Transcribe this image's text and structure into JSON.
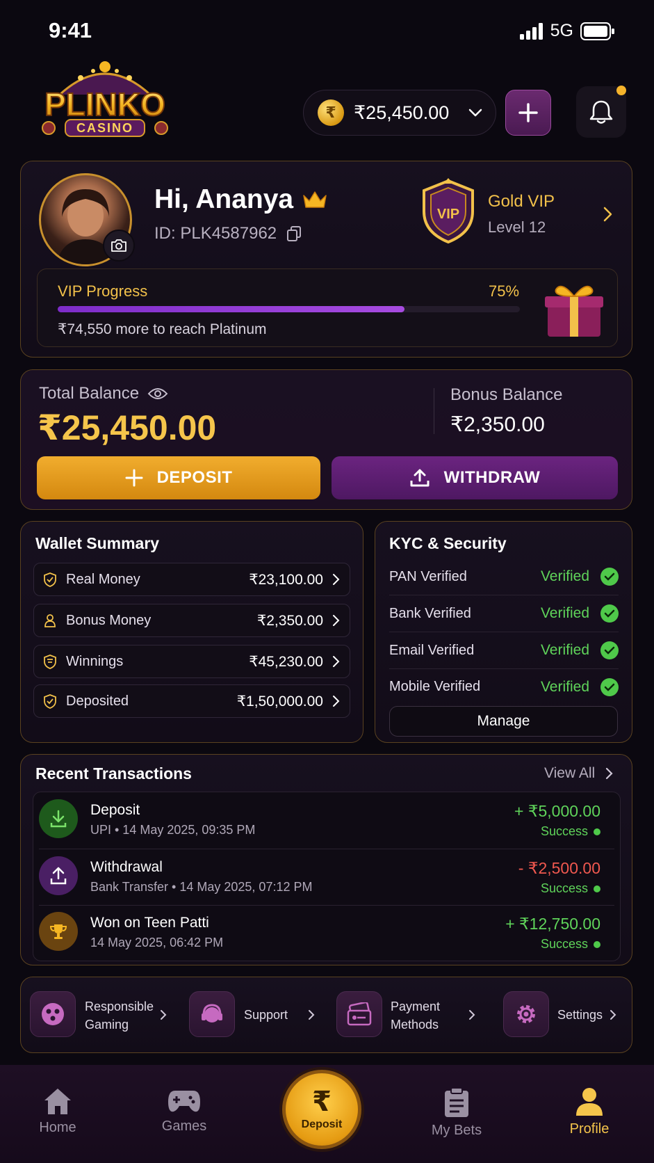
{
  "status_bar": {
    "time": "9:41",
    "network": "5G"
  },
  "header": {
    "logo_main": "PLINKO",
    "logo_sub": "CASINO",
    "balance": "₹25,450.00",
    "coin_symbol": "₹"
  },
  "profile": {
    "greeting": "Hi, Ananya",
    "user_id": "ID: PLK4587962",
    "vip_badge": "VIP",
    "vip_tier": "Gold VIP",
    "vip_level": "Level 12",
    "progress_label": "VIP Progress",
    "progress_percent_text": "75%",
    "progress_fraction": 0.75,
    "progress_note": "₹74,550 more to reach Platinum"
  },
  "balance": {
    "total_label": "Total Balance",
    "total_amount": "₹25,450.00",
    "bonus_label": "Bonus Balance",
    "bonus_amount": "₹2,350.00",
    "deposit_label": "DEPOSIT",
    "withdraw_label": "WITHDRAW"
  },
  "wallet_summary": {
    "title": "Wallet Summary",
    "rows": [
      {
        "label": "Real Money",
        "value": "₹23,100.00"
      },
      {
        "label": "Bonus Money",
        "value": "₹2,350.00"
      },
      {
        "label": "Winnings",
        "value": "₹45,230.00"
      },
      {
        "label": "Deposited",
        "value": "₹1,50,000.00"
      }
    ]
  },
  "kyc": {
    "title": "KYC & Security",
    "rows": [
      {
        "label": "PAN Verified",
        "status": "Verified"
      },
      {
        "label": "Bank Verified",
        "status": "Verified"
      },
      {
        "label": "Email Verified",
        "status": "Verified"
      },
      {
        "label": "Mobile Verified",
        "status": "Verified"
      }
    ],
    "manage_label": "Manage"
  },
  "transactions": {
    "title": "Recent Transactions",
    "view_all": "View All",
    "items": [
      {
        "title": "Deposit",
        "subtitle": "UPI • 14 May 2025, 09:35 PM",
        "amount": "+ ₹5,000.00",
        "status": "Success"
      },
      {
        "title": "Withdrawal",
        "subtitle": "Bank Transfer • 14 May 2025, 07:12 PM",
        "amount": "- ₹2,500.00",
        "status": "Success"
      },
      {
        "title": "Won on Teen Patti",
        "subtitle": "14 May 2025, 06:42 PM",
        "amount": "+ ₹12,750.00",
        "status": "Success"
      }
    ]
  },
  "quick_links": [
    {
      "label_line1": "Responsible",
      "label_line2": "Gaming"
    },
    {
      "label_line1": "Support",
      "label_line2": ""
    },
    {
      "label_line1": "Payment",
      "label_line2": "Methods"
    },
    {
      "label_line1": "Settings",
      "label_line2": ""
    }
  ],
  "bottom_nav": {
    "home": "Home",
    "games": "Games",
    "deposit_symbol": "₹",
    "deposit": "Deposit",
    "my_bets": "My Bets",
    "profile": "Profile"
  },
  "colors": {
    "accent_gold": "#f2c14a",
    "accent_purple": "#6b2480",
    "success_green": "#5fd35a",
    "debit_red": "#f0584f"
  }
}
